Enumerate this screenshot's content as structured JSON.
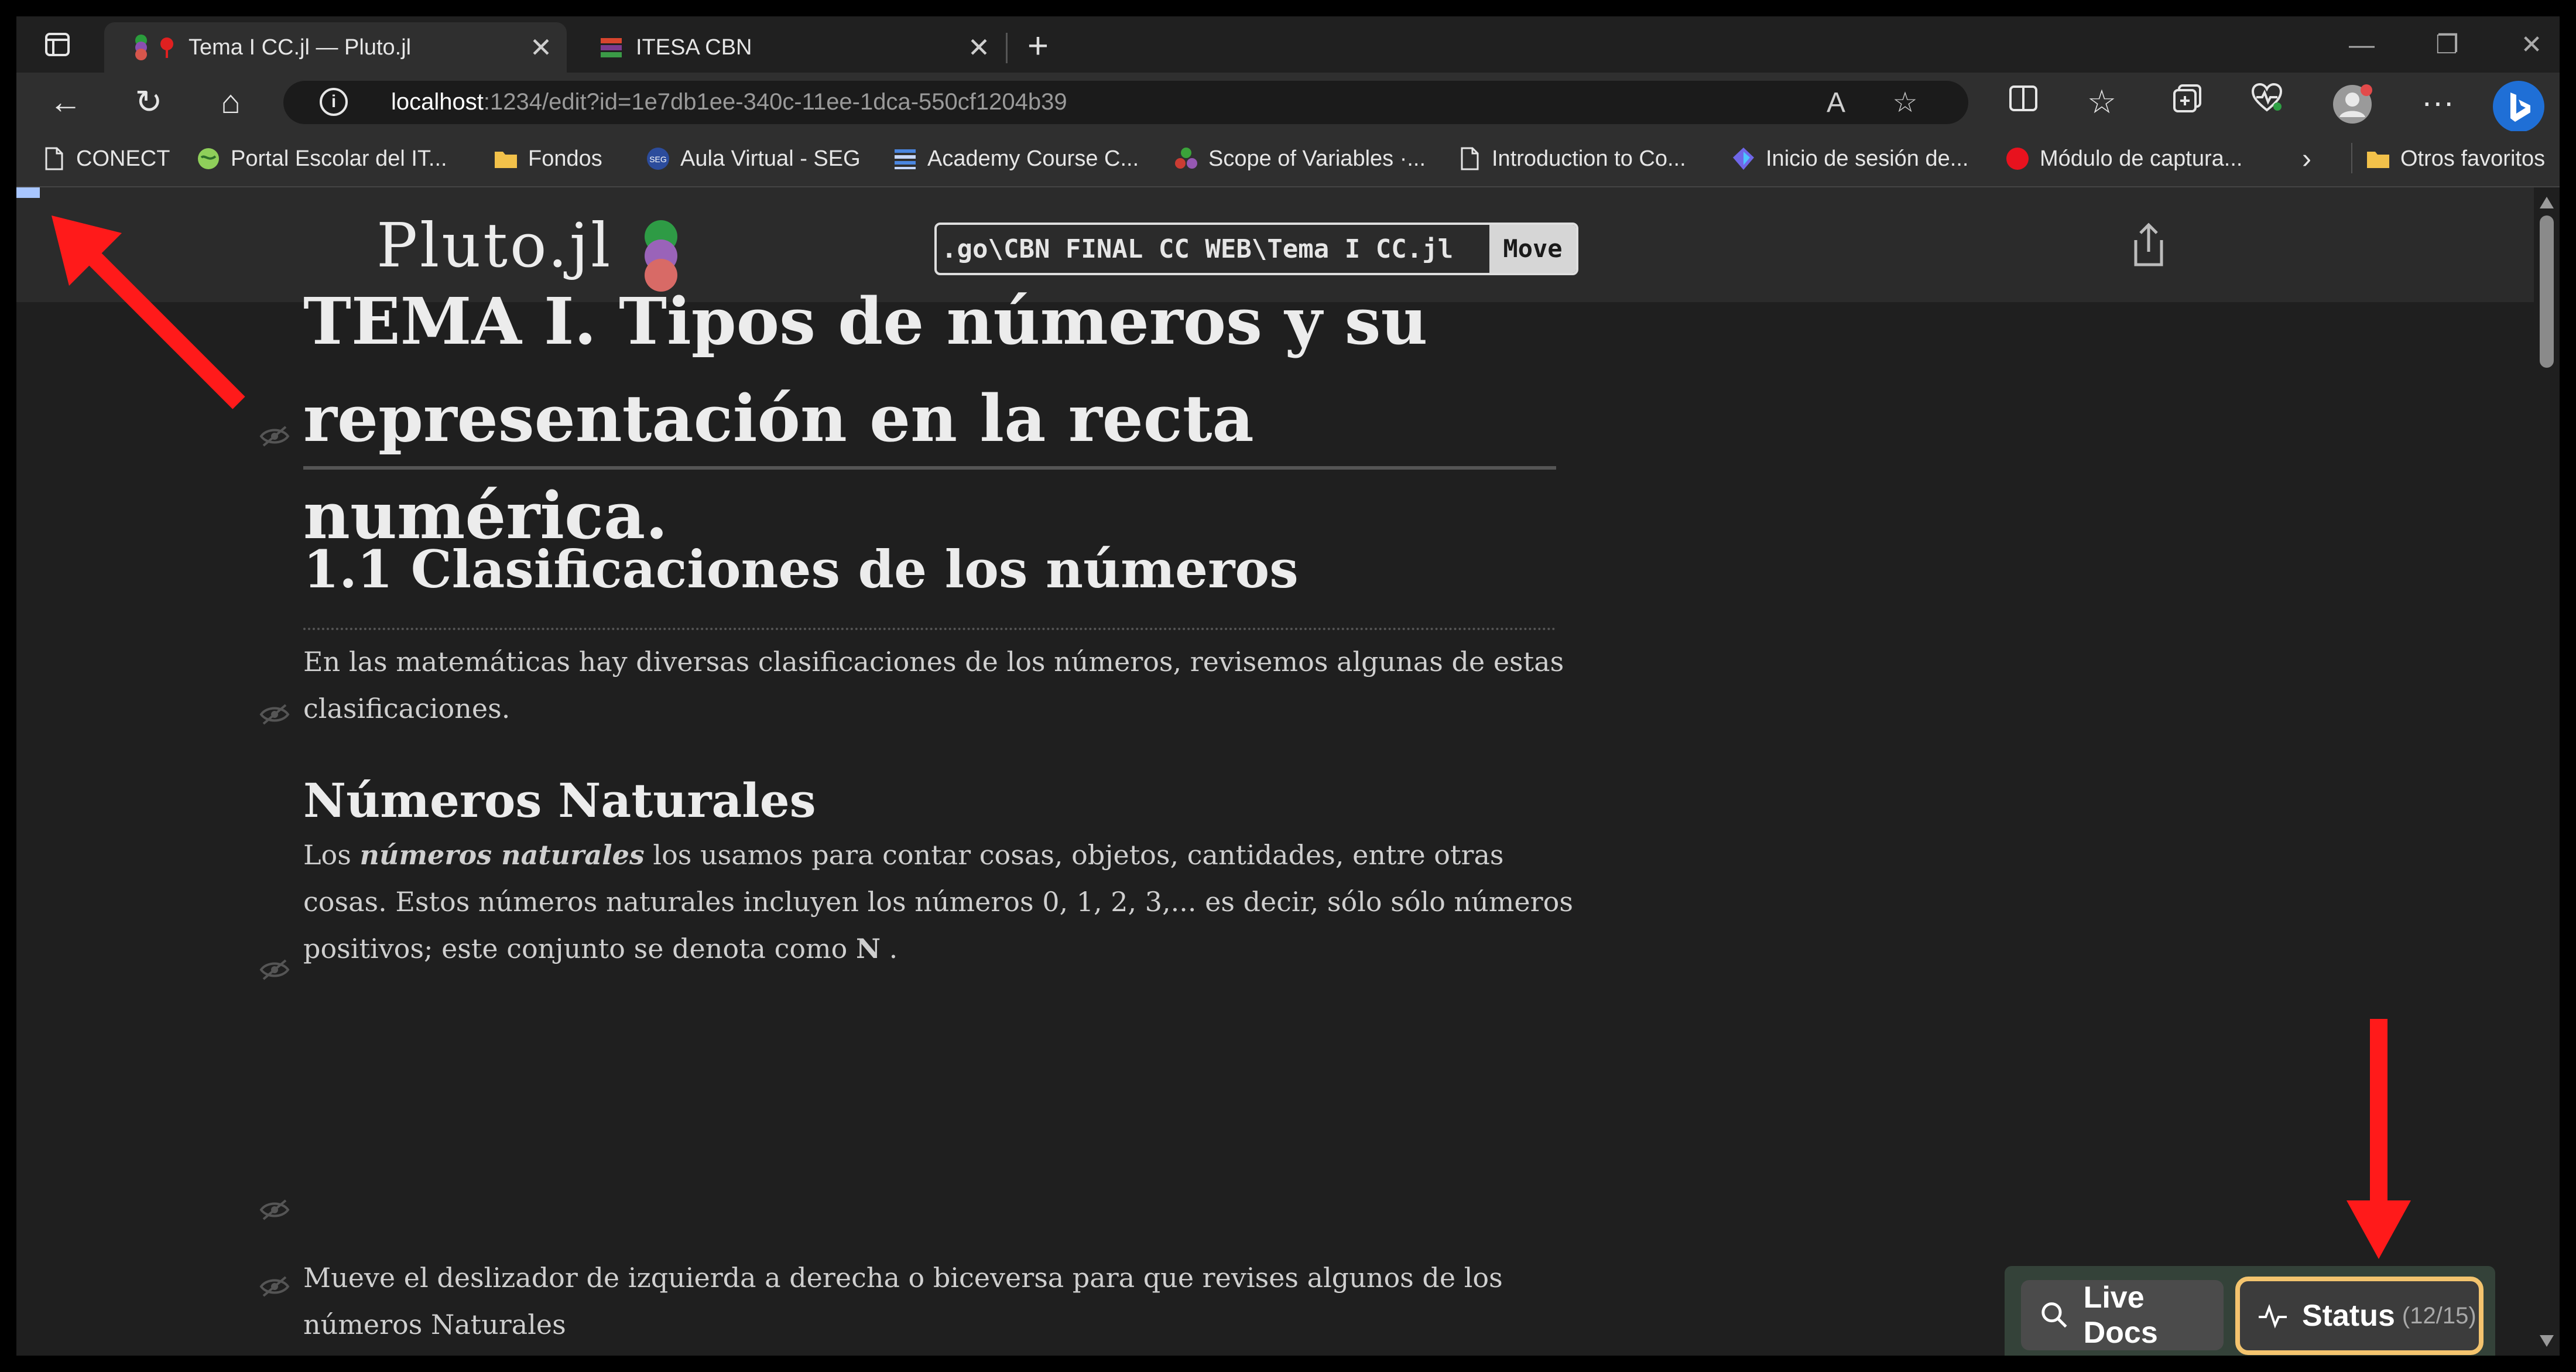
{
  "browser": {
    "tabs": [
      {
        "title": "Tema I CC.jl — Pluto.jl",
        "close": "✕",
        "active": true
      },
      {
        "title": "ITESA CBN",
        "close": "✕",
        "active": false
      }
    ],
    "new_tab": "+",
    "window_controls": {
      "minimize": "—",
      "restore": "❐",
      "close": "✕"
    },
    "address": {
      "host": "localhost",
      "rest": ":1234/edit?id=1e7db1ee-340c-11ee-1dca-550cf1204b39"
    },
    "nav": {
      "back": "←",
      "reload": "↻",
      "home": "⌂",
      "more": "···"
    },
    "bookmarks": [
      "CONECT",
      "Portal Escolar del IT...",
      "Fondos",
      "Aula Virtual - SEG",
      "Academy Course C...",
      "Scope of Variables ·...",
      "Introduction to Co...",
      "Inicio de sesión de...",
      "Módulo de captura..."
    ],
    "bookmarks_overflow": "›",
    "other_favorites": "Otros favoritos"
  },
  "pluto": {
    "logo_main": "Pluto",
    "logo_suffix": ".jl",
    "path_value": ".go\\CBN FINAL CC WEB\\Tema I CC.jl",
    "move_label": "Move"
  },
  "notebook": {
    "title": "TEMA I. Tipos de números y su representación en la recta numérica.",
    "section_heading": "1.1 Clasificaciones de los números",
    "section_intro": "En las matemáticas hay diversas clasificaciones de los números, revisemos algunas de estas clasificaciones.",
    "naturales_heading": "Números Naturales",
    "naturales_pre": "Los ",
    "naturales_em": "números naturales",
    "naturales_post": " los usamos para contar cosas, objetos, cantidades, entre otras cosas. Estos números naturales incluyen los números 0, 1, 2, 3,... es decir, sólo sólo números positivos; este conjunto se denota como ",
    "naturales_symbol": "N",
    "naturales_end": " .",
    "slider_instructions": "Mueve el deslizador de izquierda a derecha o biceversa para que revises algunos de los números Naturales"
  },
  "bottom_panel": {
    "live_docs": "Live Docs",
    "status": "Status",
    "status_count": "(12/15)"
  },
  "colors": {
    "annotation_arrow": "#ff1a1a",
    "status_border": "#f3c46e"
  }
}
